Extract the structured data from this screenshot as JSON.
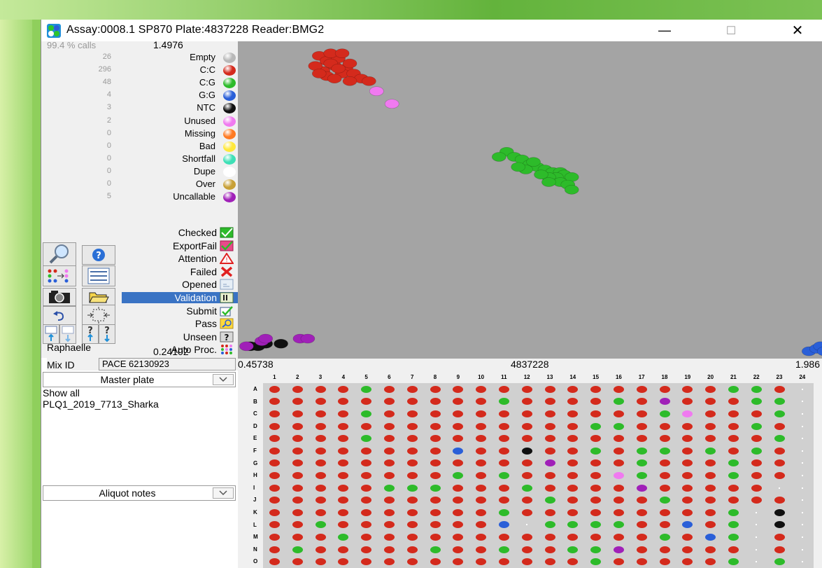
{
  "window": {
    "title": "Assay:0008.1 SP870  Plate:4837228  Reader:BMG2",
    "minimize_glyph": "—",
    "maximize_glyph": "☐",
    "close_glyph": "✕"
  },
  "legend": {
    "calls_label": "99.4 % calls",
    "calls_value": "1.4976",
    "items": [
      {
        "count": "26",
        "label": "Empty",
        "color": "#b8b8b8"
      },
      {
        "count": "296",
        "label": "C:C",
        "color": "#d42a1c"
      },
      {
        "count": "48",
        "label": "C:G",
        "color": "#2dbb2a"
      },
      {
        "count": "4",
        "label": "G:G",
        "color": "#2a5fd8"
      },
      {
        "count": "3",
        "label": "NTC",
        "color": "#101010"
      },
      {
        "count": "2",
        "label": "Unused",
        "color": "#f07af0"
      },
      {
        "count": "0",
        "label": "Missing",
        "color": "#ff7a22"
      },
      {
        "count": "0",
        "label": "Bad",
        "color": "#ffe83a"
      },
      {
        "count": "0",
        "label": "Shortfall",
        "color": "#3ee0b6"
      },
      {
        "count": "0",
        "label": "Dupe",
        "color": "#ffffff"
      },
      {
        "count": "0",
        "label": "Over",
        "color": "#c8a036"
      },
      {
        "count": "5",
        "label": "Uncallable",
        "color": "#a020b8"
      }
    ]
  },
  "status": {
    "items": [
      {
        "label": "Checked",
        "icon": "check-green-icon"
      },
      {
        "label": "ExportFail",
        "icon": "check-red-icon"
      },
      {
        "label": "Attention",
        "icon": "warning-icon"
      },
      {
        "label": "Failed",
        "icon": "cross-icon"
      },
      {
        "label": "Opened",
        "icon": "opened-icon"
      },
      {
        "label": "Validation",
        "icon": "validation-icon",
        "selected": true
      },
      {
        "label": "Submit",
        "icon": "submit-icon"
      },
      {
        "label": "Pass",
        "icon": "pass-icon"
      },
      {
        "label": "Unseen",
        "icon": "question-icon"
      },
      {
        "label": "Auto Proc.",
        "icon": "autoproc-icon"
      }
    ]
  },
  "user": {
    "name": "Raphaelle",
    "value": "0.24102"
  },
  "mix": {
    "label": "Mix ID",
    "value": "PACE 62130923"
  },
  "master_plate": {
    "label": "Master plate",
    "show_all": "Show all",
    "plate_name": "PLQ1_2019_7713_Sharka"
  },
  "aliquot_notes": {
    "label": "Aliquot notes"
  },
  "axis": {
    "min": "0.45738",
    "center": "4837228",
    "max": "1.986"
  },
  "plate": {
    "columns": [
      "1",
      "2",
      "3",
      "4",
      "5",
      "6",
      "7",
      "8",
      "9",
      "10",
      "11",
      "12",
      "13",
      "14",
      "15",
      "16",
      "17",
      "18",
      "19",
      "20",
      "21",
      "22",
      "23",
      "24"
    ],
    "rows": [
      "A",
      "B",
      "C",
      "D",
      "E",
      "F",
      "G",
      "H",
      "I",
      "J",
      "K",
      "L",
      "M",
      "N",
      "O"
    ],
    "grid": [
      "RRRRGRRRRRRRRRRRRRRRGGR_",
      "RRRRRRRRRRGRRRRGRURRRGG_",
      "RRRRGRRRRRRRRRRRRGPRRRG_",
      "RRRRRRRRRRRRRRGGRRRRRGR_",
      "RRRRGRRRRRRRRRRRRRRRRRG_",
      "RRRRRRRRBRRKRRGRGGRGRGR_",
      "RRRRRRRRRRRRURRRGRRRGRR_",
      "RRRRRRRRGRGRRRRPGRRRGRR_",
      "RRRRRGGGRRRGRRRRURRRRR__",
      "RRRRRRRRRRRRGRRRRGRRRRR_",
      "RRRRRRRRRRGRRRRRRRRRG_K_",
      "RRGRRRRRRRB_GGGGRRBRG_K_",
      "RRRGRRRRRRRRRRRRRGRBG_R_",
      "RGRRRRRGRRGRRGGURRRRR_R_",
      "RRRRRRRRRRRRRRGRRRRRG_G_"
    ]
  },
  "scatter": {
    "x_range": [
      0.45738,
      1.986
    ],
    "y_range": [
      0.24102,
      1.4976
    ],
    "clusters": [
      {
        "call": "C:C",
        "points": [
          [
            0.67,
            1.44
          ],
          [
            0.69,
            1.42
          ],
          [
            0.71,
            1.4
          ],
          [
            0.68,
            1.38
          ],
          [
            0.72,
            1.43
          ],
          [
            0.7,
            1.41
          ],
          [
            0.74,
            1.39
          ],
          [
            0.73,
            1.37
          ],
          [
            0.69,
            1.36
          ],
          [
            0.75,
            1.41
          ],
          [
            0.66,
            1.4
          ],
          [
            0.71,
            1.35
          ],
          [
            0.76,
            1.37
          ],
          [
            0.78,
            1.35
          ],
          [
            0.7,
            1.45
          ],
          [
            0.73,
            1.45
          ],
          [
            0.67,
            1.37
          ],
          [
            0.75,
            1.34
          ],
          [
            0.8,
            1.34
          ],
          [
            0.72,
            1.39
          ]
        ]
      },
      {
        "call": "Unused",
        "points": [
          [
            0.82,
            1.3
          ],
          [
            0.86,
            1.25
          ]
        ]
      },
      {
        "call": "C:G",
        "points": [
          [
            1.16,
            1.06
          ],
          [
            1.14,
            1.04
          ],
          [
            1.18,
            1.04
          ],
          [
            1.2,
            1.03
          ],
          [
            1.22,
            1.01
          ],
          [
            1.24,
            1.0
          ],
          [
            1.26,
            0.99
          ],
          [
            1.28,
            0.98
          ],
          [
            1.3,
            0.98
          ],
          [
            1.31,
            0.97
          ],
          [
            1.29,
            0.96
          ],
          [
            1.27,
            0.96
          ],
          [
            1.33,
            0.96
          ],
          [
            1.25,
            0.97
          ],
          [
            1.21,
            0.99
          ],
          [
            1.3,
            0.94
          ],
          [
            1.32,
            0.93
          ],
          [
            1.27,
            0.94
          ],
          [
            1.33,
            0.91
          ],
          [
            1.23,
            1.02
          ],
          [
            1.19,
            1.0
          ]
        ]
      },
      {
        "call": "NTC",
        "points": [
          [
            0.49,
            0.29
          ],
          [
            0.51,
            0.29
          ],
          [
            0.53,
            0.3
          ],
          [
            0.57,
            0.3
          ]
        ]
      },
      {
        "call": "Uncallable",
        "points": [
          [
            0.48,
            0.29
          ],
          [
            0.52,
            0.31
          ],
          [
            0.62,
            0.32
          ],
          [
            0.64,
            0.32
          ],
          [
            0.53,
            0.32
          ]
        ]
      },
      {
        "call": "G:G",
        "points": [
          [
            1.95,
            0.27
          ],
          [
            1.97,
            0.28
          ],
          [
            1.98,
            0.29
          ],
          [
            1.99,
            0.27
          ]
        ]
      }
    ]
  }
}
